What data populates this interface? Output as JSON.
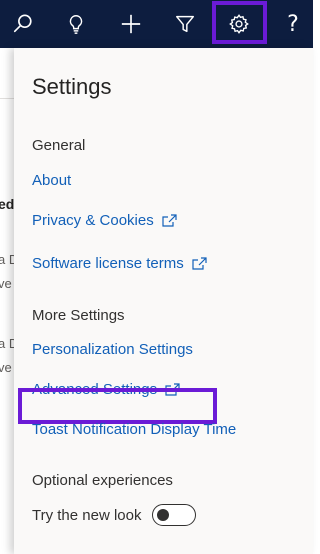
{
  "topbar": {
    "buttons": [
      {
        "name": "search-icon"
      },
      {
        "name": "lightbulb-icon"
      },
      {
        "name": "add-icon"
      },
      {
        "name": "filter-icon"
      },
      {
        "name": "gear-icon"
      },
      {
        "name": "help-icon",
        "glyph": "?"
      }
    ],
    "background": "#0d1d3f",
    "highlight_color": "#6b1bd6"
  },
  "background_page": {
    "fragments": [
      "ed",
      "a D",
      "ve",
      "a D",
      "ve"
    ]
  },
  "settings": {
    "title": "Settings",
    "general": {
      "heading": "General",
      "about": "About",
      "privacy": "Privacy & Cookies",
      "license": "Software license terms"
    },
    "more": {
      "heading": "More Settings",
      "personalization": "Personalization Settings",
      "advanced": "Advanced Settings",
      "toast": "Toast Notification Display Time"
    },
    "optional": {
      "heading": "Optional experiences",
      "new_look_label": "Try the new look",
      "new_look_on": false
    },
    "link_color": "#1260b8"
  }
}
